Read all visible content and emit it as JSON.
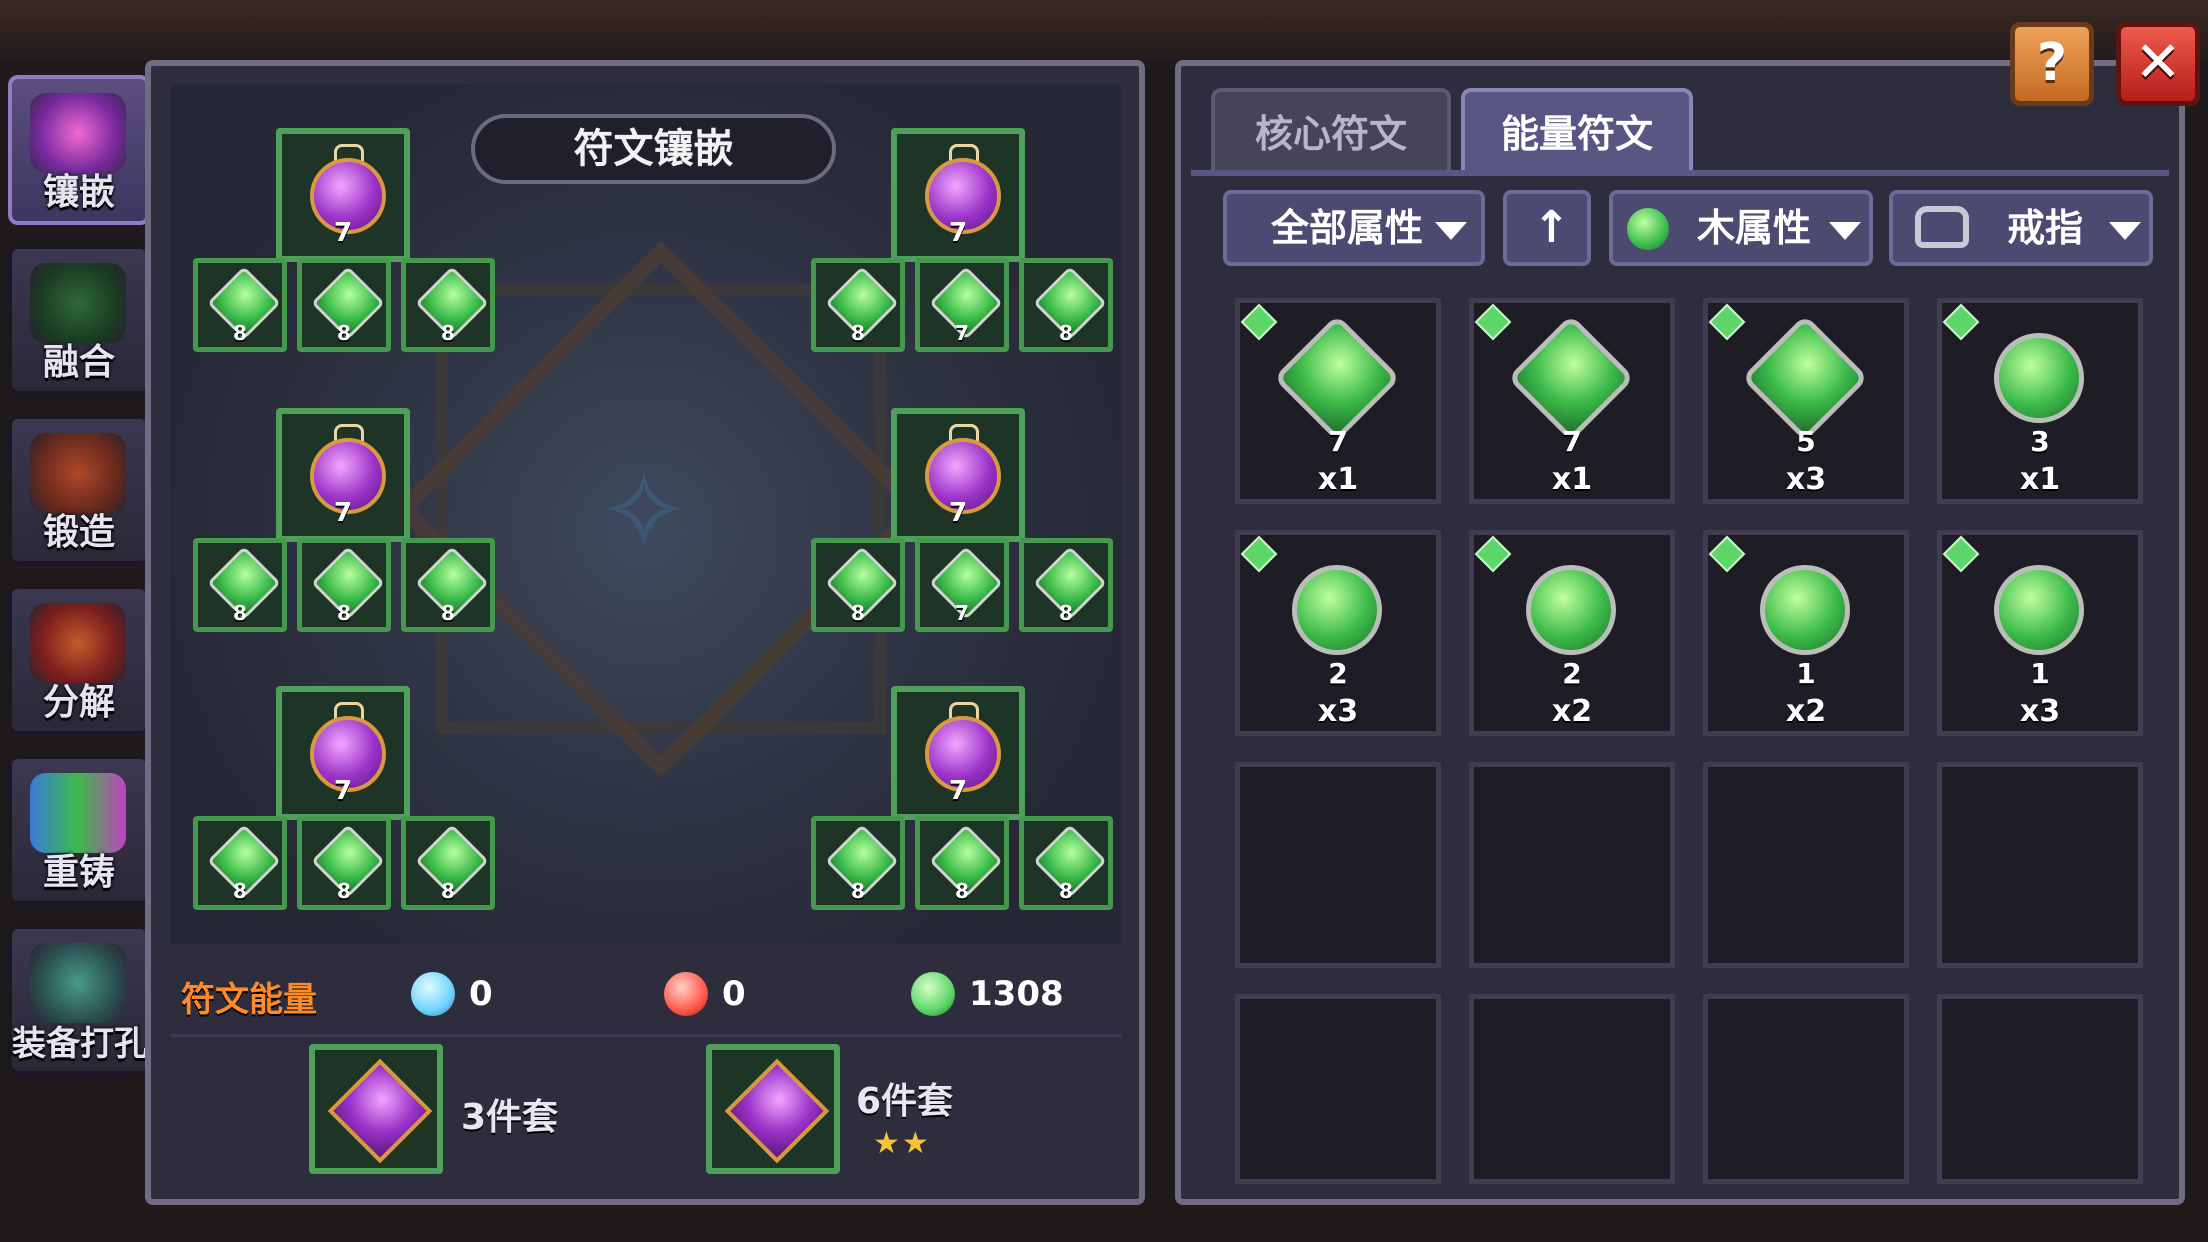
{
  "nav": [
    {
      "label": "镶嵌",
      "icon": "inlay-icon",
      "active": true
    },
    {
      "label": "融合",
      "icon": "fusion-icon",
      "active": false
    },
    {
      "label": "锻造",
      "icon": "forge-icon",
      "active": false
    },
    {
      "label": "分解",
      "icon": "decompose-icon",
      "active": false
    },
    {
      "label": "重铸",
      "icon": "reforge-icon",
      "active": false
    },
    {
      "label": "装备打孔",
      "icon": "socket-icon",
      "active": false
    }
  ],
  "board": {
    "title": "符文镶嵌",
    "core_slots": [
      {
        "level": "7"
      },
      {
        "level": "7"
      },
      {
        "level": "7"
      },
      {
        "level": "7"
      },
      {
        "level": "7"
      },
      {
        "level": "7"
      }
    ],
    "energy_rows": [
      [
        "8",
        "8",
        "8",
        "8",
        "7",
        "8"
      ],
      [
        "8",
        "8",
        "8",
        "8",
        "7",
        "8"
      ],
      [
        "8",
        "8",
        "8",
        "8",
        "8",
        "8"
      ]
    ]
  },
  "energy": {
    "label": "符文能量",
    "items": [
      {
        "icon": "water-rune-icon",
        "value": "0",
        "color": "#6fd4ff"
      },
      {
        "icon": "fire-rune-icon",
        "value": "0",
        "color": "#ff5a4a"
      },
      {
        "icon": "wood-rune-icon",
        "value": "1308",
        "color": "#5ed66a"
      }
    ]
  },
  "sets": [
    {
      "label": "3件套",
      "stars": ""
    },
    {
      "label": "6件套",
      "stars": "★★"
    }
  ],
  "tabs": [
    {
      "label": "核心符文",
      "active": false
    },
    {
      "label": "能量符文",
      "active": true
    }
  ],
  "filters": {
    "all_attr": "全部属性",
    "sort_icon": "↑",
    "wood_attr": "木属性",
    "ring": "戒指"
  },
  "inventory": [
    {
      "level": "7",
      "count": "x1",
      "shape": "big"
    },
    {
      "level": "7",
      "count": "x1",
      "shape": "big"
    },
    {
      "level": "5",
      "count": "x3",
      "shape": "big"
    },
    {
      "level": "3",
      "count": "x1",
      "shape": "round"
    },
    {
      "level": "2",
      "count": "x3",
      "shape": "round"
    },
    {
      "level": "2",
      "count": "x2",
      "shape": "round"
    },
    {
      "level": "1",
      "count": "x2",
      "shape": "round"
    },
    {
      "level": "1",
      "count": "x3",
      "shape": "round"
    }
  ],
  "buttons": {
    "help": "?",
    "close": "✕"
  }
}
